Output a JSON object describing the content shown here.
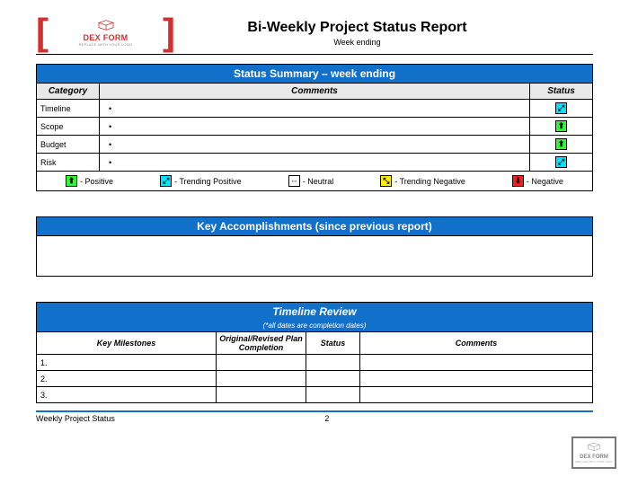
{
  "logo": {
    "brand": "DEX FORM",
    "tagline": "REPLACE WITH YOUR LOGO"
  },
  "header": {
    "title": "Bi-Weekly Project Status Report",
    "subtitle": "Week ending"
  },
  "statusSummary": {
    "title": "Status Summary – week ending",
    "columns": {
      "category": "Category",
      "comments": "Comments",
      "status": "Status"
    },
    "rows": [
      {
        "category": "Timeline",
        "comment": "•",
        "status": "trending-positive"
      },
      {
        "category": "Scope",
        "comment": "•",
        "status": "positive"
      },
      {
        "category": "Budget",
        "comment": "•",
        "status": "positive"
      },
      {
        "category": "Risk",
        "comment": "•",
        "status": "trending-positive"
      }
    ],
    "legend": [
      {
        "badge": "positive",
        "label": "- Positive"
      },
      {
        "badge": "trending-positive",
        "label": "- Trending Positive"
      },
      {
        "badge": "neutral",
        "label": "- Neutral"
      },
      {
        "badge": "trending-negative",
        "label": "- Trending Negative"
      },
      {
        "badge": "negative",
        "label": "- Negative"
      }
    ]
  },
  "accomplishments": {
    "title": "Key Accomplishments (since previous report)"
  },
  "timeline": {
    "title": "Timeline Review",
    "subtitle": "(*all dates are completion dates)",
    "columns": {
      "milestones": "Key Milestones",
      "plan": "Original/Revised Plan Completion",
      "status": "Status",
      "comments": "Comments"
    },
    "rows": [
      {
        "num": "1."
      },
      {
        "num": "2."
      },
      {
        "num": "3."
      }
    ]
  },
  "footer": {
    "left": "Weekly Project Status",
    "page": "2"
  },
  "watermark": {
    "brand": "DEX FORM",
    "tagline": "REPLACE WITH YOUR LOGO"
  },
  "glyphs": {
    "positive": "⬆",
    "trending-positive": "⤢",
    "neutral": "⇔",
    "trending-negative": "⤡",
    "negative": "⬇"
  },
  "badgeClass": {
    "positive": "badge-green",
    "trending-positive": "badge-cyan",
    "neutral": "badge-white",
    "trending-negative": "badge-yellow",
    "negative": "badge-red"
  }
}
